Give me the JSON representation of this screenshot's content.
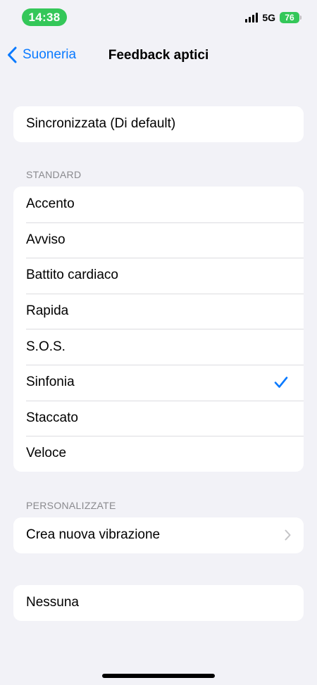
{
  "status_bar": {
    "time": "14:38",
    "network": "5G",
    "battery": "76"
  },
  "nav": {
    "back_label": "Suoneria",
    "title": "Feedback aptici"
  },
  "top_group": {
    "items": [
      {
        "label": "Sincronizzata (Di default)"
      }
    ]
  },
  "standard": {
    "header": "STANDARD",
    "items": [
      {
        "label": "Accento"
      },
      {
        "label": "Avviso"
      },
      {
        "label": "Battito cardiaco"
      },
      {
        "label": "Rapida"
      },
      {
        "label": "S.O.S."
      },
      {
        "label": "Sinfonia",
        "selected": true
      },
      {
        "label": "Staccato"
      },
      {
        "label": "Veloce"
      }
    ]
  },
  "custom": {
    "header": "PERSONALIZZATE",
    "items": [
      {
        "label": "Crea nuova vibrazione"
      }
    ]
  },
  "none_group": {
    "items": [
      {
        "label": "Nessuna"
      }
    ]
  },
  "colors": {
    "accent": "#0a7aff",
    "time_pill": "#34c759",
    "battery": "#34c759",
    "background": "#f2f2f7"
  },
  "icons": {
    "back": "chevron-left-icon",
    "selected": "checkmark-icon",
    "disclosure": "chevron-right-icon"
  }
}
